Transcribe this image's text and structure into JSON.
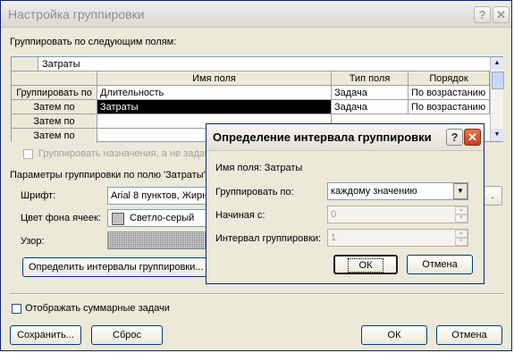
{
  "dialog": {
    "title": "Настройка группировки",
    "group_by_label": "Группировать по следующим полям:",
    "grid": {
      "top_row_value": "Затраты",
      "columns": [
        "Имя поля",
        "Тип поля",
        "Порядок"
      ],
      "rows": [
        {
          "label": "Группировать по",
          "field": "Длительность",
          "type": "Задача",
          "order": "По возрастанию"
        },
        {
          "label": "Затем по",
          "field": "Затраты",
          "type": "Задача",
          "order": "По возрастанию"
        },
        {
          "label": "Затем по",
          "field": "",
          "type": "",
          "order": ""
        },
        {
          "label": "Затем по",
          "field": "",
          "type": "",
          "order": ""
        }
      ]
    },
    "group_assignments_label": "Группировать назначения, а не задачи",
    "params_label": "Параметры группировки по полю 'Затраты'",
    "font_label": "Шрифт:",
    "font_value": "Arial 8 пунктов, Жирн",
    "cell_bg_label": "Цвет фона ячеек:",
    "cell_bg_value": "Светло-серый",
    "pattern_label": "Узор:",
    "define_intervals_button": "Определить интервалы группировки...",
    "show_summary_label": "Отображать суммарные задачи",
    "save_button": "Сохранить...",
    "reset_button": "Сброс",
    "ok_button": "ОК",
    "cancel_button": "Отмена"
  },
  "subdialog": {
    "title": "Определение интервала группировки",
    "field_name_label": "Имя поля: Затраты",
    "group_by_label": "Группировать по:",
    "group_by_value": "каждому значению",
    "start_label": "Начиная с:",
    "start_value": "0",
    "interval_label": "Интервал группировки:",
    "interval_value": "1",
    "ok_button": "ОК",
    "cancel_button": "Отмена"
  }
}
